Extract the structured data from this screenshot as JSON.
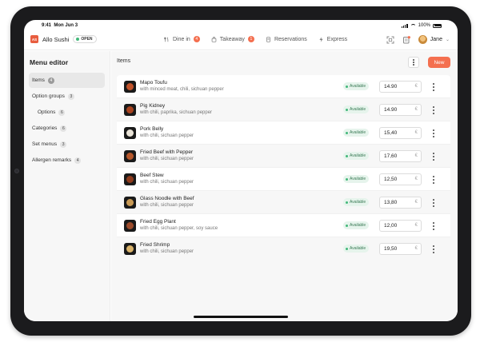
{
  "statusbar": {
    "time": "9:41",
    "date": "Mon Jun 3",
    "battery": "100%"
  },
  "restaurant": {
    "logo_text": "AS",
    "name": "Allo Sushi",
    "status": "OPEN"
  },
  "topnav": [
    {
      "label": "Dine in",
      "badge": "4",
      "icon": "fork-knife-icon"
    },
    {
      "label": "Takeaway",
      "badge": "1",
      "icon": "bag-icon"
    },
    {
      "label": "Reservations",
      "badge": "",
      "icon": "book-icon"
    },
    {
      "label": "Express",
      "badge": "",
      "icon": "bolt-icon"
    }
  ],
  "user": {
    "name": "Jane"
  },
  "sidebar": {
    "title": "Menu editor",
    "items": [
      {
        "label": "Items",
        "count": "4"
      },
      {
        "label": "Option groups",
        "count": "3"
      },
      {
        "label": "Options",
        "count": "6"
      },
      {
        "label": "Categories",
        "count": "6"
      },
      {
        "label": "Set menus",
        "count": "3"
      },
      {
        "label": "Allergen remarks",
        "count": "4"
      }
    ]
  },
  "main": {
    "title": "Items",
    "new_label": "New"
  },
  "availability_label": "Available",
  "currency_symbol": "€",
  "items": [
    {
      "name": "Mapo Toufu",
      "description": "with minced meat, chili, sichuan pepper",
      "price": "14.90",
      "color": "#c0522a"
    },
    {
      "name": "Pig Kidney",
      "description": "with chili, paprika, sichuan pepper",
      "price": "14.90",
      "color": "#a8431f"
    },
    {
      "name": "Pork Belly",
      "description": "with chili, sichuan pepper",
      "price": "15,40",
      "color": "#e9e3d7"
    },
    {
      "name": "Fried Beef with Pepper",
      "description": "with chili, sichuan pepper",
      "price": "17,60",
      "color": "#b5562a"
    },
    {
      "name": "Beef Stew",
      "description": "with chili, sichuan pepper",
      "price": "12,50",
      "color": "#8e3b1c"
    },
    {
      "name": "Glass Noodle with Beef",
      "description": "with chili, sichuan pepper",
      "price": "13,80",
      "color": "#c99a55"
    },
    {
      "name": "Fried Egg Plant",
      "description": "with chili, sichuan pepper, soy sauce",
      "price": "12,00",
      "color": "#9b4a2a"
    },
    {
      "name": "Fried Shrimp",
      "description": "with chili, sichuan pepper",
      "price": "19,50",
      "color": "#d9b36b"
    }
  ]
}
